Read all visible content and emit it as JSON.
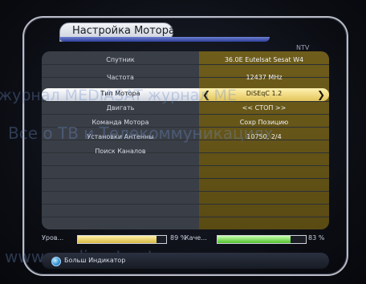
{
  "header": {
    "title": "Настройка Мотора",
    "channel_label": "NTV"
  },
  "rows": [
    {
      "label": "Спутник",
      "value": "36.0E Eutelsat Sesat W4"
    },
    {
      "label": "Частота",
      "value": "12437 MHz"
    },
    {
      "label": "Тип Мотора",
      "value": "DiSEqC 1.2",
      "selected": true
    },
    {
      "label": "Двигать",
      "value": "<< СТОП >>"
    },
    {
      "label": "Команда Мотора",
      "value": "Сохр Позицию"
    },
    {
      "label": "Установки Антенны",
      "value": "10750, 2/4"
    },
    {
      "label": "Поиск Каналов",
      "value": ""
    }
  ],
  "signal": {
    "level_label": "Уров...",
    "level_percent": 89,
    "level_text": "89 %",
    "quality_label": "Каче...",
    "quality_percent": 83,
    "quality_text": "83 %"
  },
  "footer": {
    "hint": "Больш Индикатор"
  },
  "watermark": {
    "line1": "журнал MEDIASAT    журнал ME",
    "line2": "Все о ТВ и Телекоммуникациях",
    "line3": "www.mediasat.net.ua          www.m"
  },
  "colors": {
    "selected_left": "#ffffff",
    "selected_right": "#e2c45a",
    "left_panel": "#3a3f47",
    "right_panel": "#6b5b1c"
  }
}
